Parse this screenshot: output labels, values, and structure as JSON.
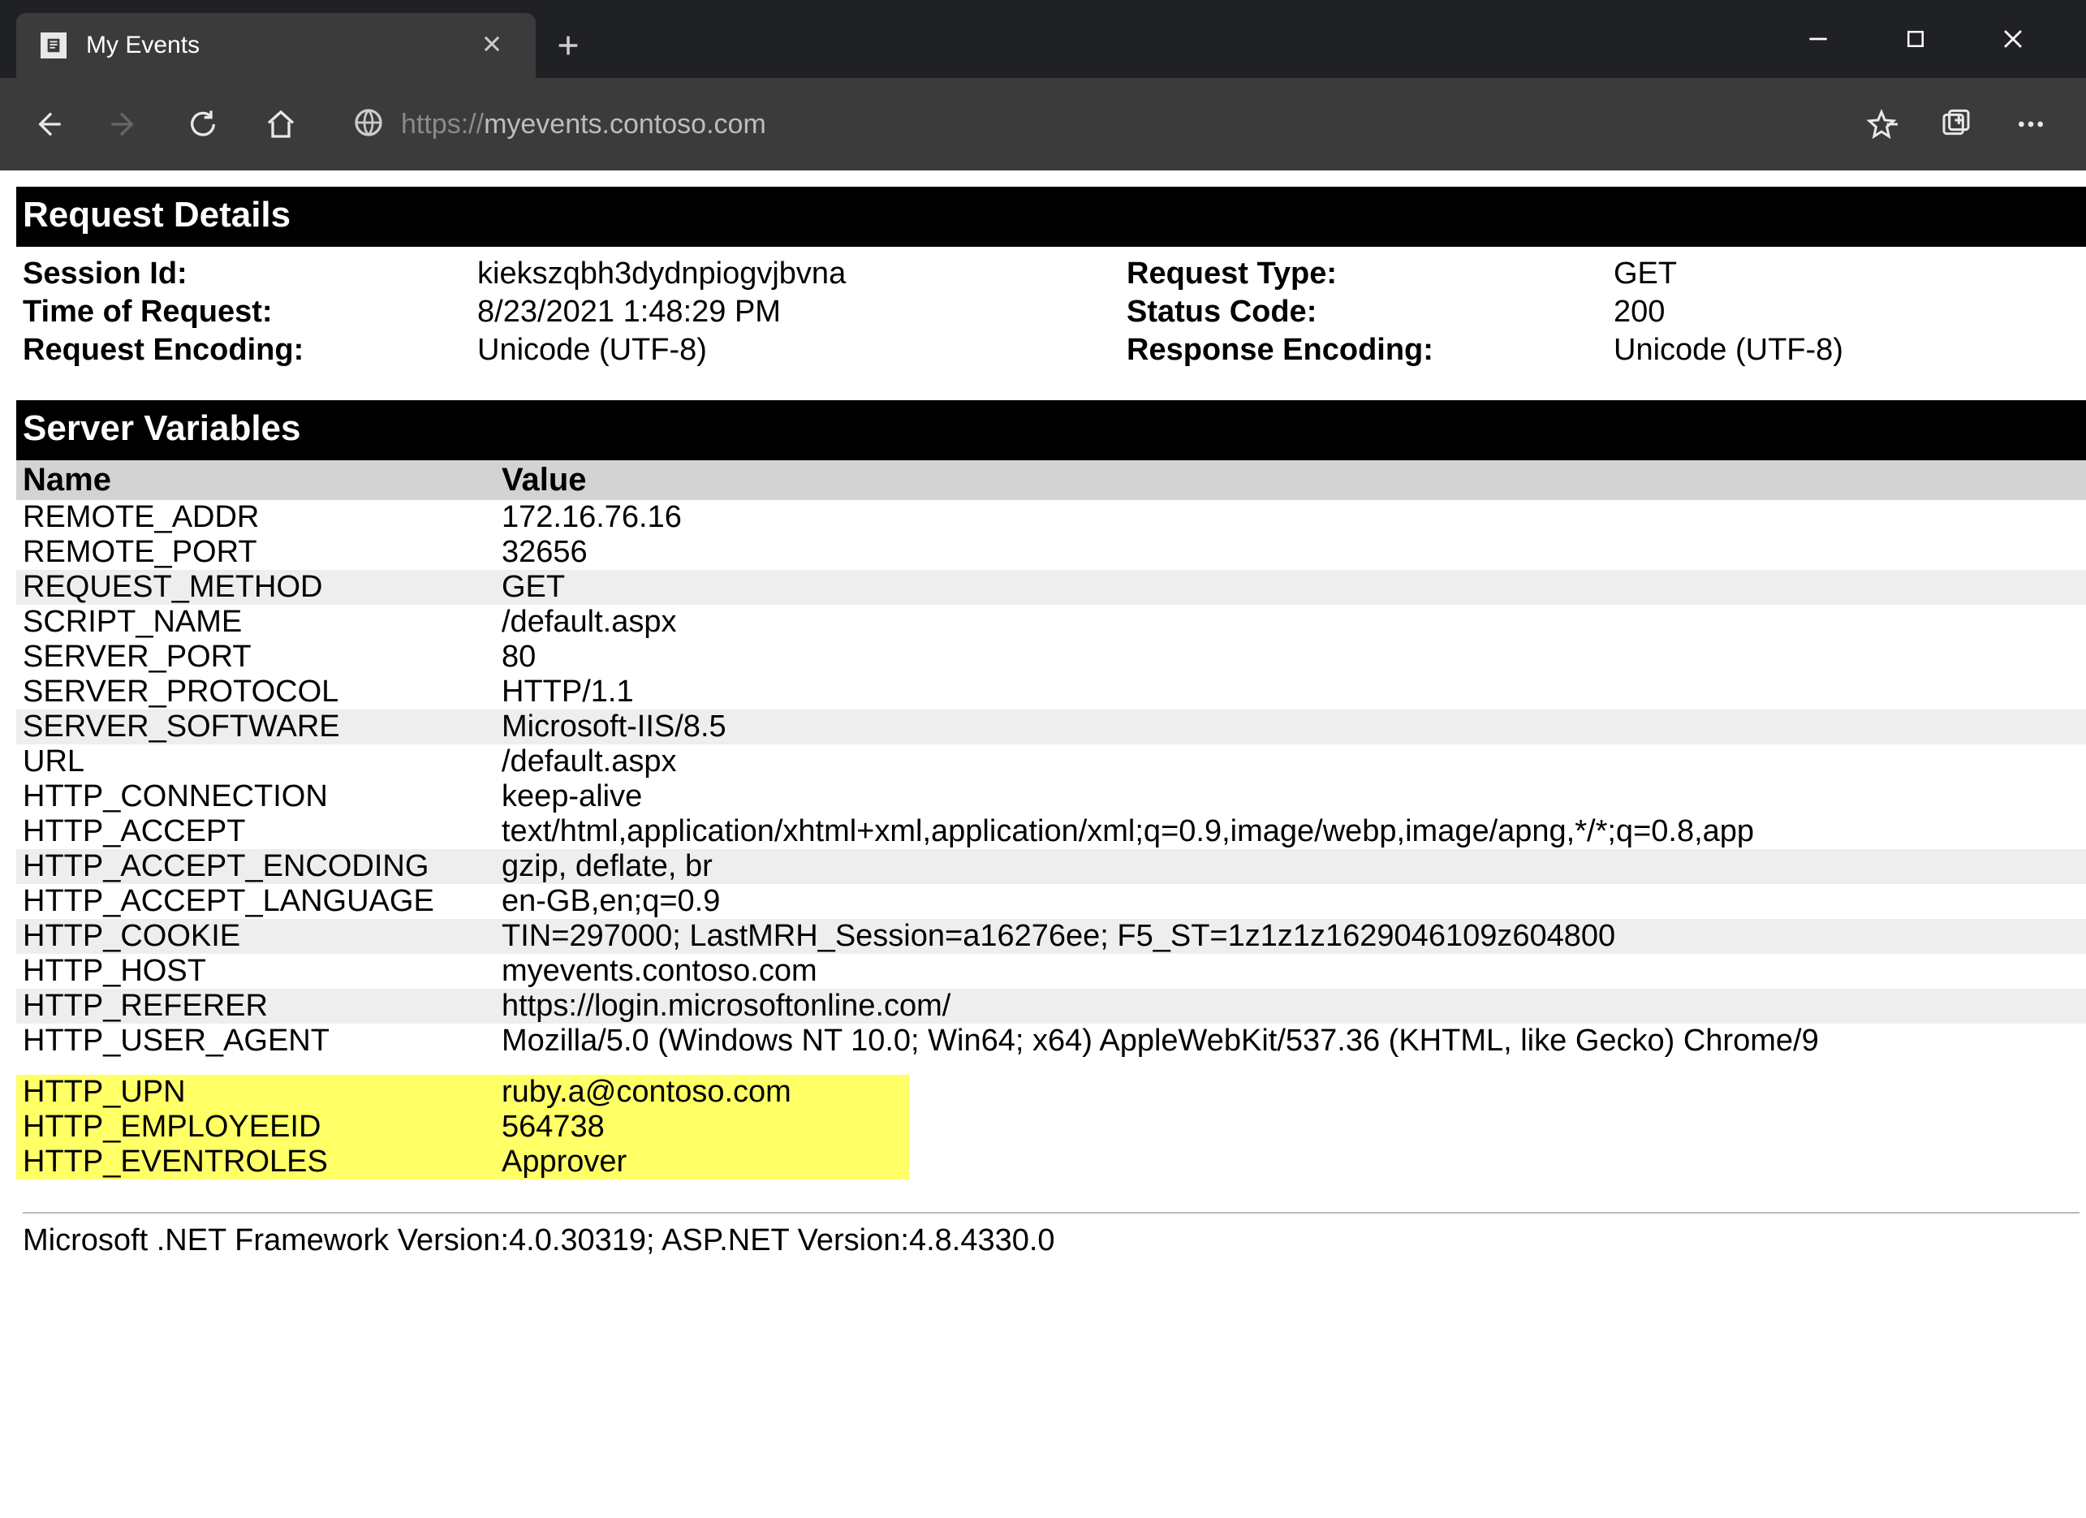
{
  "browser": {
    "tab_title": "My Events",
    "url_scheme": "https://",
    "url_host": "myevents.contoso.com"
  },
  "section_headers": {
    "request_details": "Request Details",
    "server_variables": "Server Variables"
  },
  "request_details": {
    "session_id_label": "Session Id:",
    "session_id": "kiekszqbh3dydnpiogvjbvna",
    "request_type_label": "Request Type:",
    "request_type": "GET",
    "time_label": "Time of Request:",
    "time": "8/23/2021 1:48:29 PM",
    "status_code_label": "Status Code:",
    "status_code": "200",
    "req_enc_label": "Request Encoding:",
    "req_enc": "Unicode (UTF-8)",
    "resp_enc_label": "Response Encoding:",
    "resp_enc": "Unicode (UTF-8)"
  },
  "vars_header": {
    "name": "Name",
    "value": "Value"
  },
  "server_variables": [
    {
      "name": "REMOTE_ADDR",
      "value": "172.16.76.16",
      "striped": false
    },
    {
      "name": "REMOTE_PORT",
      "value": "32656",
      "striped": false
    },
    {
      "name": "REQUEST_METHOD",
      "value": "GET",
      "striped": true
    },
    {
      "name": "SCRIPT_NAME",
      "value": "/default.aspx",
      "striped": false
    },
    {
      "name": "SERVER_PORT",
      "value": "80",
      "striped": false
    },
    {
      "name": "SERVER_PROTOCOL",
      "value": "HTTP/1.1",
      "striped": false
    },
    {
      "name": "SERVER_SOFTWARE",
      "value": "Microsoft-IIS/8.5",
      "striped": true
    },
    {
      "name": "URL",
      "value": "/default.aspx",
      "striped": false
    },
    {
      "name": "HTTP_CONNECTION",
      "value": "keep-alive",
      "striped": false
    },
    {
      "name": "HTTP_ACCEPT",
      "value": "text/html,application/xhtml+xml,application/xml;q=0.9,image/webp,image/apng,*/*;q=0.8,app",
      "striped": false
    },
    {
      "name": "HTTP_ACCEPT_ENCODING",
      "value": "gzip, deflate, br",
      "striped": true
    },
    {
      "name": "HTTP_ACCEPT_LANGUAGE",
      "value": "en-GB,en;q=0.9",
      "striped": false
    },
    {
      "name": "HTTP_COOKIE",
      "value": "TIN=297000; LastMRH_Session=a16276ee; F5_ST=1z1z1z1629046109z604800",
      "striped": true
    },
    {
      "name": "HTTP_HOST",
      "value": "myevents.contoso.com",
      "striped": false
    },
    {
      "name": "HTTP_REFERER",
      "value": "https://login.microsoftonline.com/",
      "striped": true
    },
    {
      "name": "HTTP_USER_AGENT",
      "value": "Mozilla/5.0 (Windows NT 10.0; Win64; x64) AppleWebKit/537.36 (KHTML, like Gecko) Chrome/9",
      "striped": false
    }
  ],
  "highlighted_variables": [
    {
      "name": "HTTP_UPN",
      "value": "ruby.a@contoso.com"
    },
    {
      "name": "HTTP_EMPLOYEEID",
      "value": "564738"
    },
    {
      "name": "HTTP_EVENTROLES",
      "value": "Approver"
    }
  ],
  "footer": "Microsoft .NET Framework Version:4.0.30319; ASP.NET Version:4.8.4330.0"
}
